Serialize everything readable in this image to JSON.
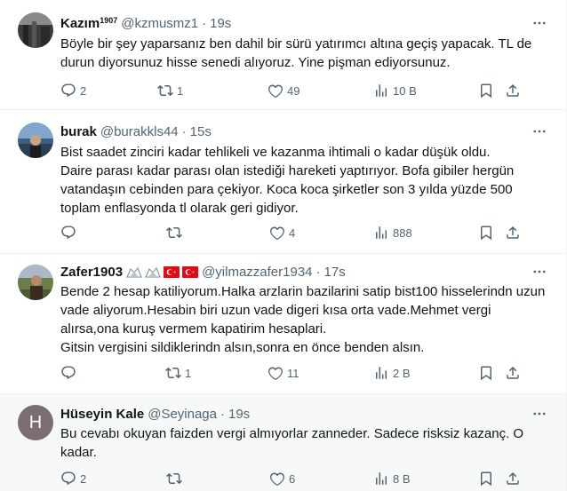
{
  "tweets": [
    {
      "name": "Kazım",
      "name_sup": "1907",
      "handle": "@kzmusmz1",
      "separator": "·",
      "time": "19s",
      "text": "Böyle bir şey yaparsanız ben dahil bir sürü yatırımcı altına geçiş yapacak. TL de durun diyorsunuz hisse senedi alıyoruz. Yine pişman ediyorsunuz.",
      "replies": "2",
      "retweets": "1",
      "likes": "49",
      "views": "10 B"
    },
    {
      "name": "burak",
      "handle": "@burakkls44",
      "separator": "·",
      "time": "15s",
      "text": "Bist saadet zinciri kadar tehlikeli ve kazanma ihtimali o kadar düşük oldu.\nDaire parası kadar parası olan istediği hareketi yaptırıyor. Bofa gibiler hergün vatandaşın cebinden para çekiyor. Koca koca şirketler son 3 yılda yüzde 500 toplam enflasyonda tl olarak geri gidiyor.",
      "replies": "",
      "retweets": "",
      "likes": "4",
      "views": "888"
    },
    {
      "name": "Zafer1903",
      "handle": "@yilmazzafer1934",
      "separator": "·",
      "time": "17s",
      "text": "Bende 2 hesap katiliyorum.Halka arzlarin bazilarini satip bist100 hisselerindn uzun vade aliyorum.Hesabin biri uzun vade digeri kısa orta vade.Mehmet vergi alırsa,ona kuruş vermem kapatirim hesaplari.\nGitsin vergisini sildiklerindn alsın,sonra en önce benden alsın.",
      "replies": "",
      "retweets": "1",
      "likes": "11",
      "views": "2 B"
    },
    {
      "name": "Hüseyin Kale",
      "handle": "@Seyinaga",
      "separator": "·",
      "time": "19s",
      "avatar_letter": "H",
      "text": "Bu cevabı okuyan faizden vergi almıyorlar zanneder. Sadece risksiz kazanç. O kadar.",
      "replies": "2",
      "retweets": "",
      "likes": "6",
      "views": "8 B"
    }
  ],
  "icons": {
    "more": "more-horizontal-icon",
    "reply": "reply-icon",
    "retweet": "retweet-icon",
    "like": "heart-icon",
    "views": "views-chart-icon",
    "bookmark": "bookmark-icon",
    "share": "share-icon"
  },
  "colors": {
    "secondary_text": "#536471",
    "divider": "#eff3f4",
    "highlight_bg": "#f7f9f9"
  }
}
